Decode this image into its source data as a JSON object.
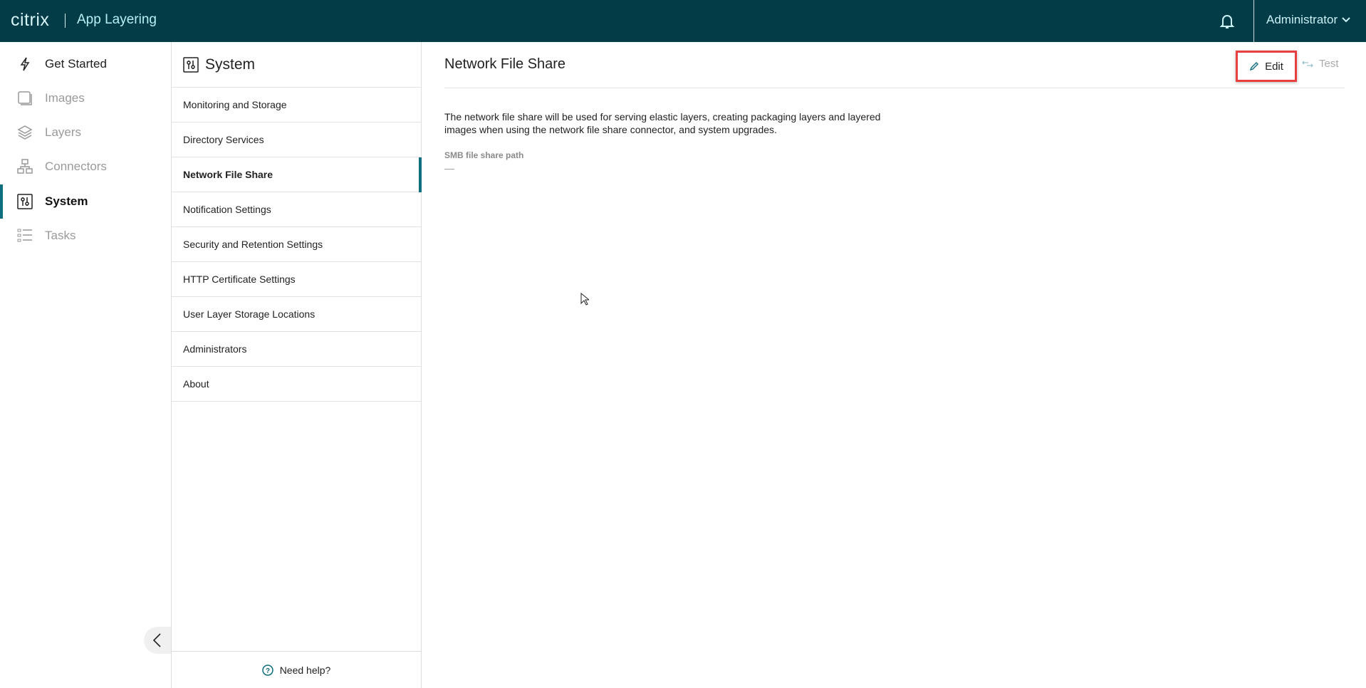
{
  "header": {
    "logo": "citrix",
    "app_title": "App Layering",
    "user": "Administrator"
  },
  "leftnav": {
    "items": [
      {
        "label": "Get Started",
        "icon": "lightning-icon"
      },
      {
        "label": "Images",
        "icon": "images-icon"
      },
      {
        "label": "Layers",
        "icon": "layers-icon"
      },
      {
        "label": "Connectors",
        "icon": "connectors-icon"
      },
      {
        "label": "System",
        "icon": "system-icon"
      },
      {
        "label": "Tasks",
        "icon": "tasks-icon"
      }
    ]
  },
  "panel": {
    "title": "System",
    "items": [
      "Monitoring and Storage",
      "Directory Services",
      "Network File Share",
      "Notification Settings",
      "Security and Retention Settings",
      "HTTP Certificate Settings",
      "User Layer Storage Locations",
      "Administrators",
      "About"
    ],
    "help": "Need help?"
  },
  "main": {
    "title": "Network File Share",
    "edit": "Edit",
    "test": "Test",
    "description": "The network file share will be used for serving elastic layers, creating packaging layers and layered images when using the network file share connector, and system upgrades.",
    "field_label": "SMB file share path",
    "field_value": "—"
  },
  "colors": {
    "header": "#033b47",
    "accent": "#0f6e80",
    "highlight": "#e84040"
  }
}
